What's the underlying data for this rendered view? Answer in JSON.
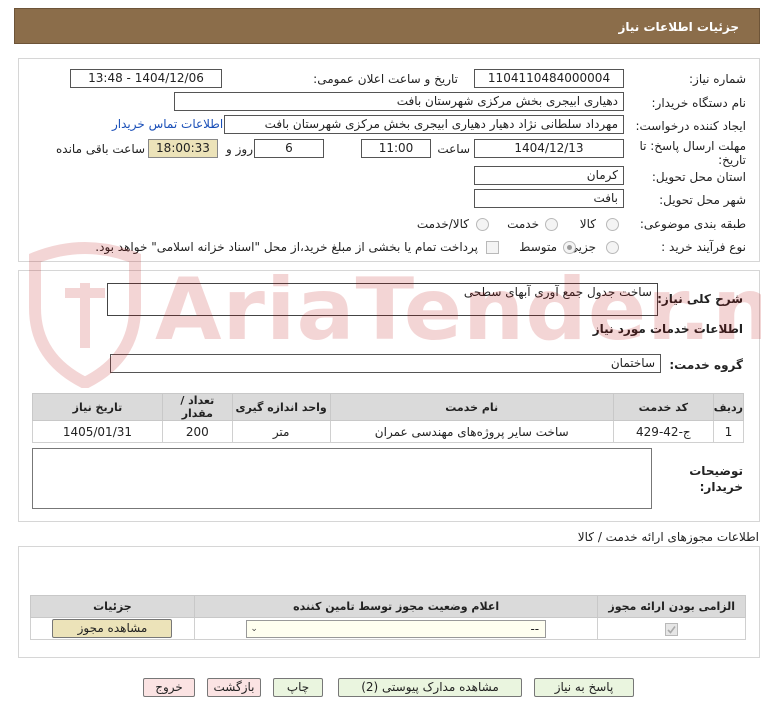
{
  "header": {
    "title": "جزئیات اطلاعات نیاز"
  },
  "need": {
    "number_label": "شماره نیاز:",
    "number": "1104110484000004",
    "announce_label": "تاریخ و ساعت اعلان عمومی:",
    "announce_value": "1404/12/06 - 13:48",
    "buyer_org_label": "نام دستگاه خریدار:",
    "buyer_org": "دهیاری ابیجری بخش مرکزی شهرستان بافت",
    "requester_label": "ایجاد کننده درخواست:",
    "requester": "مهرداد سلطانی نژاد دهیار دهیاری ابیجری بخش مرکزی شهرستان بافت",
    "contact_link": "اطلاعات تماس خریدار",
    "deadline_label_1": "مهلت ارسال پاسخ: تا",
    "deadline_label_2": "تاریخ:",
    "deadline_date": "1404/12/13",
    "time_label": "ساعت",
    "deadline_time": "11:00",
    "days_value": "6",
    "days_label": "روز و",
    "remaining_time": "18:00:33",
    "remaining_label": "ساعت باقی مانده",
    "province_label": "استان محل تحویل:",
    "province": "کرمان",
    "city_label": "شهر محل تحویل:",
    "city": "بافت",
    "category_label": "طبقه بندی موضوعی:",
    "category_options": [
      "کالا",
      "خدمت",
      "کالا/خدمت"
    ],
    "process_label": "نوع فرآیند خرید :",
    "process_options": [
      "جزیی",
      "متوسط"
    ],
    "payment_note": "پرداخت تمام یا بخشی از مبلغ خرید،از محل \"اسناد خزانه اسلامی\" خواهد بود."
  },
  "summary": {
    "label": "شرح کلی نیاز:",
    "value": "ساخت جدول جمع آوری آبهای سطحی"
  },
  "services": {
    "section_title": "اطلاعات خدمات مورد نیاز",
    "group_label": "گروه خدمت:",
    "group_value": "ساختمان",
    "columns": [
      "ردیف",
      "کد خدمت",
      "نام خدمت",
      "واحد اندازه گیری",
      "تعداد / مقدار",
      "تاریخ نیاز"
    ],
    "rows": [
      {
        "index": "1",
        "code": "ج-42-429",
        "name": "ساخت سایر پروژه‌های مهندسی عمران",
        "unit": "متر",
        "qty": "200",
        "date": "1405/01/31"
      }
    ]
  },
  "buyer_notes": {
    "label_1": "توضیحات",
    "label_2": "خریدار:",
    "value": ""
  },
  "permits": {
    "section_title": "اطلاعات مجوزهای ارائه خدمت / کالا",
    "columns": [
      "الزامی بودن ارائه مجوز",
      "اعلام وضعیت مجوز توسط تامین کننده",
      "جزئیات"
    ],
    "select_value": "--",
    "view_button": "مشاهده مجوز"
  },
  "footer": {
    "reply": "پاسخ به نیاز",
    "attachments": "مشاهده مدارک پیوستی (2)",
    "print": "چاپ",
    "back": "بازگشت",
    "exit": "خروج"
  },
  "watermark": {
    "text": "AriaTender.neT"
  },
  "colors": {
    "header": "#8b6d4a",
    "accent_link": "#1a4fb8",
    "field_tan": "#ece3b9",
    "button_green": "#eaf5df",
    "button_pink": "#fbe3e3"
  }
}
